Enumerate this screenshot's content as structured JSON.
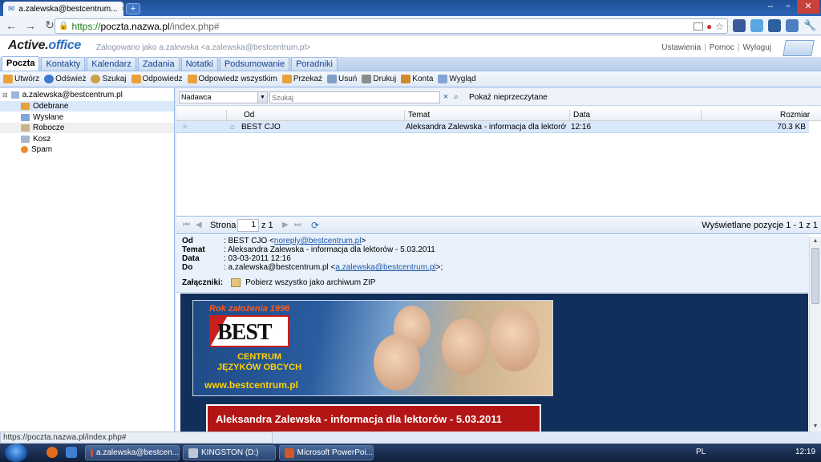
{
  "browser": {
    "tab_title": "a.zalewska@bestcentrum...",
    "tab_close": "×",
    "new_tab": "+",
    "url_https": "https://",
    "url_host": "poczta.nazwa.pl",
    "url_path": "/index.php#",
    "status_url": "https://poczta.nazwa.pl/index.php#"
  },
  "app": {
    "logo_main": "Active.",
    "logo_accent": "office",
    "logged_in": "Zalogowano jako a.zalewska <a.zalewska@bestcentrum.pl>",
    "links": [
      "Ustawienia",
      "Pomoc",
      "Wyloguj"
    ],
    "separator": "|"
  },
  "tabs": [
    "Poczta",
    "Kontakty",
    "Kalendarz",
    "Zadania",
    "Notatki",
    "Podsumowanie",
    "Poradniki"
  ],
  "actions": [
    "Utwórz",
    "Odśwież",
    "Szukaj",
    "Odpowiedz",
    "Odpowiedz wszystkim",
    "Przekaż",
    "Usuń",
    "Drukuj",
    "Konta",
    "Wygląd"
  ],
  "tree": {
    "account": "a.zalewska@bestcentrum.pl",
    "folders": [
      "Odebrane",
      "Wysłane",
      "Robocze",
      "Kosz",
      "Spam"
    ]
  },
  "filter": {
    "field": "Nadawca",
    "search_placeholder": "Szukaj",
    "clear": "×",
    "show_unread": "Pokaż nieprzeczytane"
  },
  "grid": {
    "headers": [
      "Od",
      "Temat",
      "Data",
      "Rozmiar"
    ],
    "rows": [
      {
        "from": "BEST CJO",
        "subject": "Aleksandra Zalewska - informacja dla lektorów - 5.03.2011",
        "date": "12:16",
        "size": "70.3 KB"
      }
    ]
  },
  "pager": {
    "label": "Strona",
    "page": "1",
    "of": "z 1",
    "info": "Wyświetlane pozycje 1 - 1 z 1"
  },
  "message": {
    "labels": {
      "from": "Od",
      "subject": "Temat",
      "date": "Data",
      "to": "Do",
      "attachments": "Załączniki:"
    },
    "from_name": ": BEST CJO <",
    "from_email": "noreply@bestcentrum.pl",
    "from_end": ">",
    "subject": ": Aleksandra Zalewska - informacja dla lektorów - 5.03.2011",
    "date": ": 03-03-2011 12:16",
    "to_name": ": a.zalewska@bestcentrum.pl <",
    "to_email": "a.zalewska@bestcentrum.pl",
    "to_end": ">;",
    "attach_all": "Pobierz wszystko jako archiwum ZIP"
  },
  "banner": {
    "since": "Rok założenia 1996",
    "best": "BEST",
    "centrum_line1": "CENTRUM",
    "centrum_line2": "JĘZYKÓW OBCYCH",
    "url": "www.bestcentrum.pl",
    "title": "Aleksandra Zalewska - informacja dla lektorów - 5.03.2011",
    "title_partial": "2011"
  },
  "taskbar": {
    "items": [
      "a.zalewska@bestcen...",
      "KINGSTON (D:)",
      "Microsoft PowerPoi..."
    ],
    "lang": "PL",
    "time": "12:19"
  },
  "colors": {
    "accent": "#15428b",
    "selection": "#d9e8fb",
    "banner_red": "#b31515"
  }
}
